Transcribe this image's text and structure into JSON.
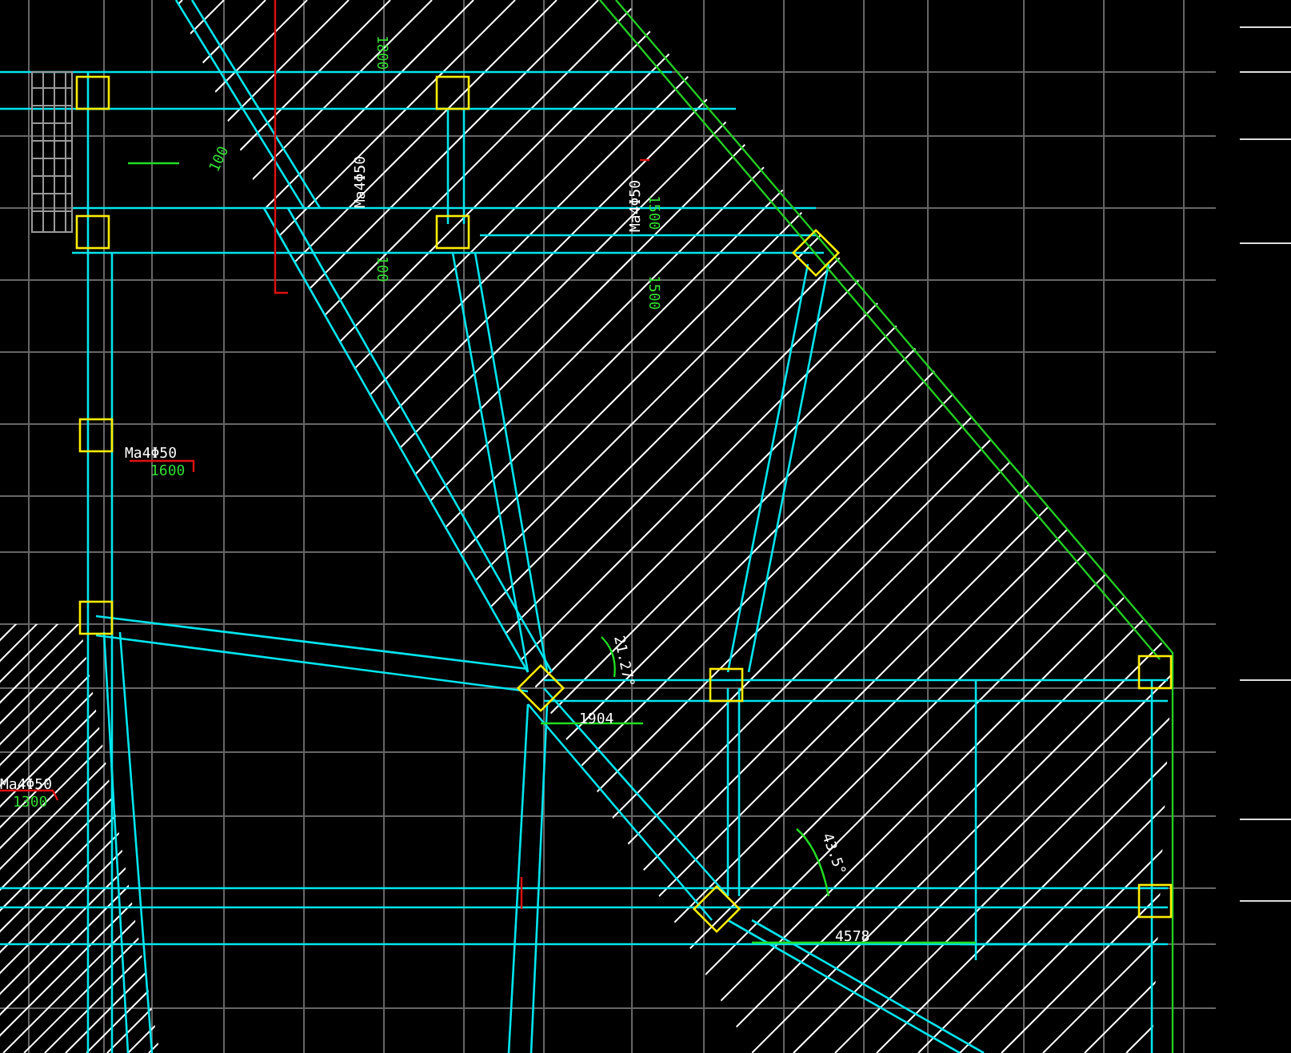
{
  "drawing": {
    "labels": [
      {
        "text": "1800",
        "kind": "dimension"
      },
      {
        "text": "100",
        "kind": "dimension"
      },
      {
        "text": "Ma4Φ50",
        "kind": "tag"
      },
      {
        "text": "100",
        "kind": "dimension"
      },
      {
        "text": "Ma4Φ50",
        "kind": "tag"
      },
      {
        "text": "1500",
        "kind": "dimension"
      },
      {
        "text": "1500",
        "kind": "dimension"
      },
      {
        "text": "Ma4Φ50",
        "kind": "tag"
      },
      {
        "text": "1600",
        "kind": "dimension"
      },
      {
        "text": "Ma4Φ50",
        "kind": "tag"
      },
      {
        "text": "1300",
        "kind": "dimension"
      },
      {
        "text": "21.27°",
        "kind": "measure"
      },
      {
        "text": "1904",
        "kind": "measure"
      },
      {
        "text": "43.5°",
        "kind": "measure"
      },
      {
        "text": "4578",
        "kind": "measure"
      }
    ]
  }
}
